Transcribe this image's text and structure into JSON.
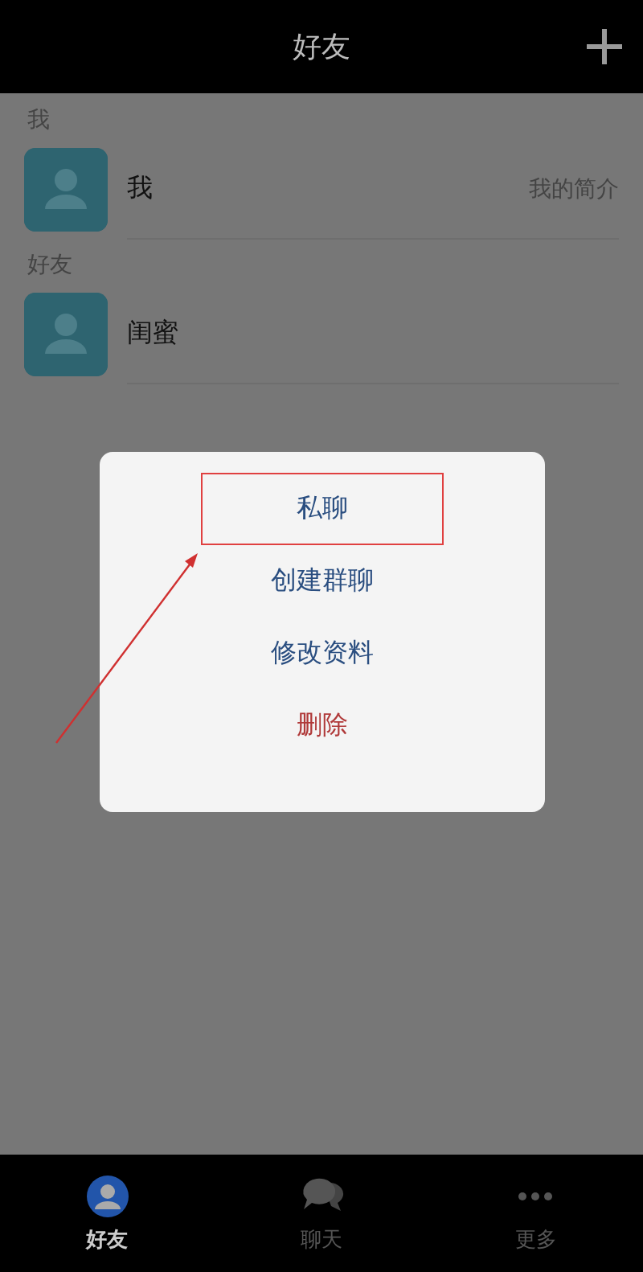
{
  "header": {
    "title": "好友"
  },
  "sections": [
    {
      "title": "我",
      "contacts": [
        {
          "name": "我",
          "subtitle": "我的简介"
        }
      ]
    },
    {
      "title": "好友",
      "contacts": [
        {
          "name": "闺蜜"
        }
      ]
    }
  ],
  "menu": {
    "items": [
      {
        "label": "私聊",
        "kind": "normal",
        "highlighted": true
      },
      {
        "label": "创建群聊",
        "kind": "normal",
        "highlighted": false
      },
      {
        "label": "修改资料",
        "kind": "normal",
        "highlighted": false
      },
      {
        "label": "删除",
        "kind": "danger",
        "highlighted": false
      }
    ]
  },
  "tabs": [
    {
      "label": "好友",
      "kind": "person",
      "selected": true
    },
    {
      "label": "聊天",
      "kind": "chat",
      "selected": false
    },
    {
      "label": "更多",
      "kind": "more",
      "selected": false
    }
  ]
}
